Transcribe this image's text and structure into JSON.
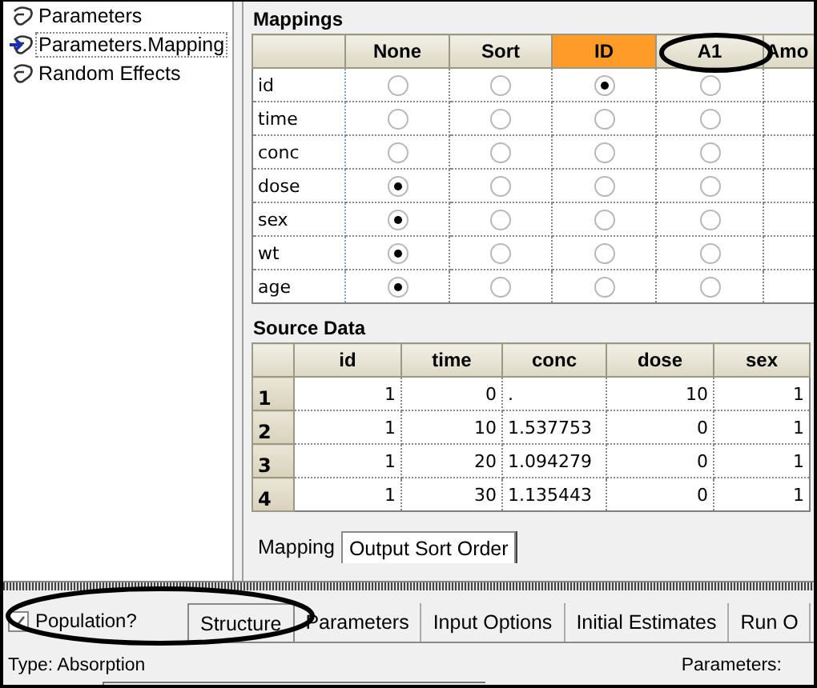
{
  "tree": {
    "items": [
      {
        "label": "Parameters",
        "selected": false
      },
      {
        "label": "Parameters.Mapping",
        "selected": true
      },
      {
        "label": "Random Effects",
        "selected": false
      }
    ]
  },
  "mappings": {
    "title": "Mappings",
    "columns": [
      {
        "label": "None",
        "selected": false
      },
      {
        "label": "Sort",
        "selected": false
      },
      {
        "label": "ID",
        "selected": true
      },
      {
        "label": "A1",
        "selected": false
      },
      {
        "label": "Amo",
        "selected": false
      }
    ],
    "rows": [
      {
        "name": "id",
        "radios": [
          {
            "selected": false
          },
          {
            "selected": false
          },
          {
            "selected": true
          },
          {
            "selected": false
          }
        ]
      },
      {
        "name": "time",
        "radios": [
          {
            "selected": false
          },
          {
            "selected": false
          },
          {
            "selected": false
          },
          {
            "selected": false
          }
        ]
      },
      {
        "name": "conc",
        "radios": [
          {
            "selected": false
          },
          {
            "selected": false
          },
          {
            "selected": false
          },
          {
            "selected": false
          }
        ]
      },
      {
        "name": "dose",
        "radios": [
          {
            "selected": true
          },
          {
            "selected": false
          },
          {
            "selected": false
          },
          {
            "selected": false
          }
        ]
      },
      {
        "name": "sex",
        "radios": [
          {
            "selected": true
          },
          {
            "selected": false
          },
          {
            "selected": false
          },
          {
            "selected": false
          }
        ]
      },
      {
        "name": "wt",
        "radios": [
          {
            "selected": true
          },
          {
            "selected": false
          },
          {
            "selected": false
          },
          {
            "selected": false
          }
        ]
      },
      {
        "name": "age",
        "radios": [
          {
            "selected": true
          },
          {
            "selected": false
          },
          {
            "selected": false
          },
          {
            "selected": false
          }
        ]
      }
    ]
  },
  "source_data": {
    "title": "Source Data",
    "columns": [
      "id",
      "time",
      "conc",
      "dose",
      "sex"
    ],
    "rows": [
      {
        "index": "1",
        "cells": [
          "1",
          "0",
          ".",
          "10",
          "1"
        ]
      },
      {
        "index": "2",
        "cells": [
          "1",
          "10",
          "1.537753",
          "0",
          "1"
        ]
      },
      {
        "index": "3",
        "cells": [
          "1",
          "20",
          "1.094279",
          "0",
          "1"
        ]
      },
      {
        "index": "4",
        "cells": [
          "1",
          "30",
          "1.135443",
          "0",
          "1"
        ]
      }
    ]
  },
  "sub_tabs": [
    {
      "label": "Mapping",
      "selected": true
    },
    {
      "label": "Output Sort Order",
      "selected": false
    }
  ],
  "population": {
    "label": "Population?",
    "checked": true
  },
  "bottom_tabs": [
    {
      "label": "Structure",
      "selected": true
    },
    {
      "label": "Parameters",
      "selected": false
    },
    {
      "label": "Input Options",
      "selected": false
    },
    {
      "label": "Initial Estimates",
      "selected": false
    },
    {
      "label": "Run O",
      "selected": false
    }
  ],
  "type_label": "Type: Absorption",
  "parameters_label": "Parameters:"
}
